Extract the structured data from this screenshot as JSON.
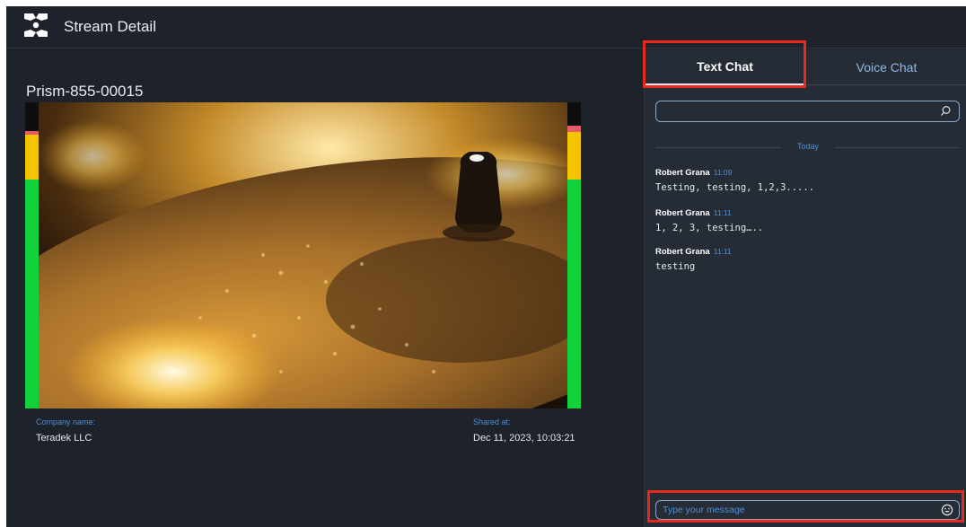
{
  "header": {
    "title": "Stream Detail",
    "logo_icon": "teradek-logo-icon"
  },
  "stream": {
    "name": "Prism-855-00015",
    "video_description_icon": "video-preview",
    "audio_meters": {
      "left": {
        "levels": [
          "red",
          "yellow",
          "green"
        ]
      },
      "right": {
        "levels": [
          "red",
          "yellow",
          "green"
        ]
      }
    },
    "company_label": "Company name:",
    "company_value": "Teradek LLC",
    "shared_label": "Shared at:",
    "shared_value": "Dec 11, 2023, 10:03:21"
  },
  "chat": {
    "tabs": [
      {
        "label": "Text Chat",
        "active": true
      },
      {
        "label": "Voice Chat",
        "active": false
      }
    ],
    "search": {
      "value": "",
      "placeholder": "",
      "icon": "search-icon"
    },
    "divider_label": "Today",
    "messages": [
      {
        "author": "Robert Grana",
        "time": "11:09",
        "text": "Testing, testing, 1,2,3....."
      },
      {
        "author": "Robert Grana",
        "time": "11:11",
        "text": "1, 2, 3, testing….."
      },
      {
        "author": "Robert Grana",
        "time": "11:11",
        "text": "testing"
      }
    ],
    "compose": {
      "placeholder": "Type your message",
      "icon": "emoji-icon"
    }
  },
  "colors": {
    "background": "#1d222b",
    "panel": "#262c36",
    "accent": "#4f8fd6",
    "highlight": "#e8291c",
    "meter_green": "#12d23c",
    "meter_yellow": "#f5c400",
    "meter_red": "#e25b66"
  }
}
